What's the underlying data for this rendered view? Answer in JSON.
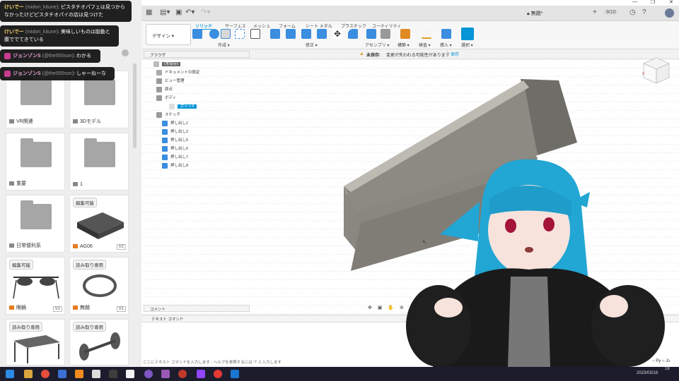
{
  "chat": [
    {
      "name": "けいでー",
      "handle": "(midori_kitune)",
      "text": ": ピスタチオパフェは見つからなかったけどピスタチオパイの店は見つけた"
    },
    {
      "name": "けいでー",
      "handle": "(midori_kitune)",
      "text": ": 美味しいものは胎動と腹ででてきている"
    },
    {
      "name": "ジョンゾンS",
      "handle": "(@the555son)",
      "text": ": わかる"
    },
    {
      "name": "ジョンゾンS",
      "handle": "(@the555son)",
      "text": ": しゃーねーな"
    }
  ],
  "files": [
    {
      "label": "VR関連",
      "kind": "folder"
    },
    {
      "label": "3Dモデル",
      "kind": "folder"
    },
    {
      "label": "重要",
      "kind": "folder"
    },
    {
      "label": "1",
      "kind": "folder"
    },
    {
      "label": "日常便利系",
      "kind": "folder"
    },
    {
      "label": "AG06",
      "kind": "model",
      "badge": "編集可能",
      "version": "V2"
    },
    {
      "label": "眼鏡",
      "kind": "model",
      "badge": "編集可能",
      "version": "V2"
    },
    {
      "label": "無題",
      "kind": "model",
      "badge": "読み取り専用",
      "version": "V1"
    },
    {
      "label": "",
      "kind": "model",
      "badge": "読み取り専用",
      "version": ""
    },
    {
      "label": "",
      "kind": "model",
      "badge": "読み取り専用",
      "version": ""
    }
  ],
  "window": {
    "title": "無題*",
    "counter": "9/10"
  },
  "ribbon": {
    "workspace": "デザイン",
    "tabs": [
      "ソリッド",
      "サーフェス",
      "メッシュ",
      "フォーム",
      "シート メタル",
      "プラスチック",
      "ユーティリティ"
    ],
    "groups": [
      "作成",
      "修正",
      "アセンブリ",
      "構築",
      "検査",
      "挿入",
      "選択"
    ]
  },
  "infobar": {
    "label": "未保存:",
    "text": "変更が失われる可能性があります",
    "save": "保存"
  },
  "browser": {
    "title": "ブラウザ",
    "root": "(未保存)",
    "items": [
      "ドキュメントの設定",
      "ビュー管理",
      "原点",
      "ボディ",
      "ボディ4",
      "スケッチ",
      "押し出し1",
      "押し出し2",
      "押し出し5",
      "押し出し6",
      "押し出し7",
      "押し出し8"
    ]
  },
  "comment_label": "コメント",
  "textcmd": {
    "title": "テキスト コマンド",
    "placeholder": "ここにテキスト コマンドを入力します - ヘルプを参照するには '?' と入力します",
    "py": "Py",
    "js": "Js"
  },
  "taskbar": {
    "date": "2023/03/18",
    "time": "18"
  },
  "colors": {
    "ribbon_accent": "#0696d7",
    "model_body": "#7d7b74",
    "avatar_hair": "#22a6d4",
    "jacket": "#1a1a1a"
  }
}
